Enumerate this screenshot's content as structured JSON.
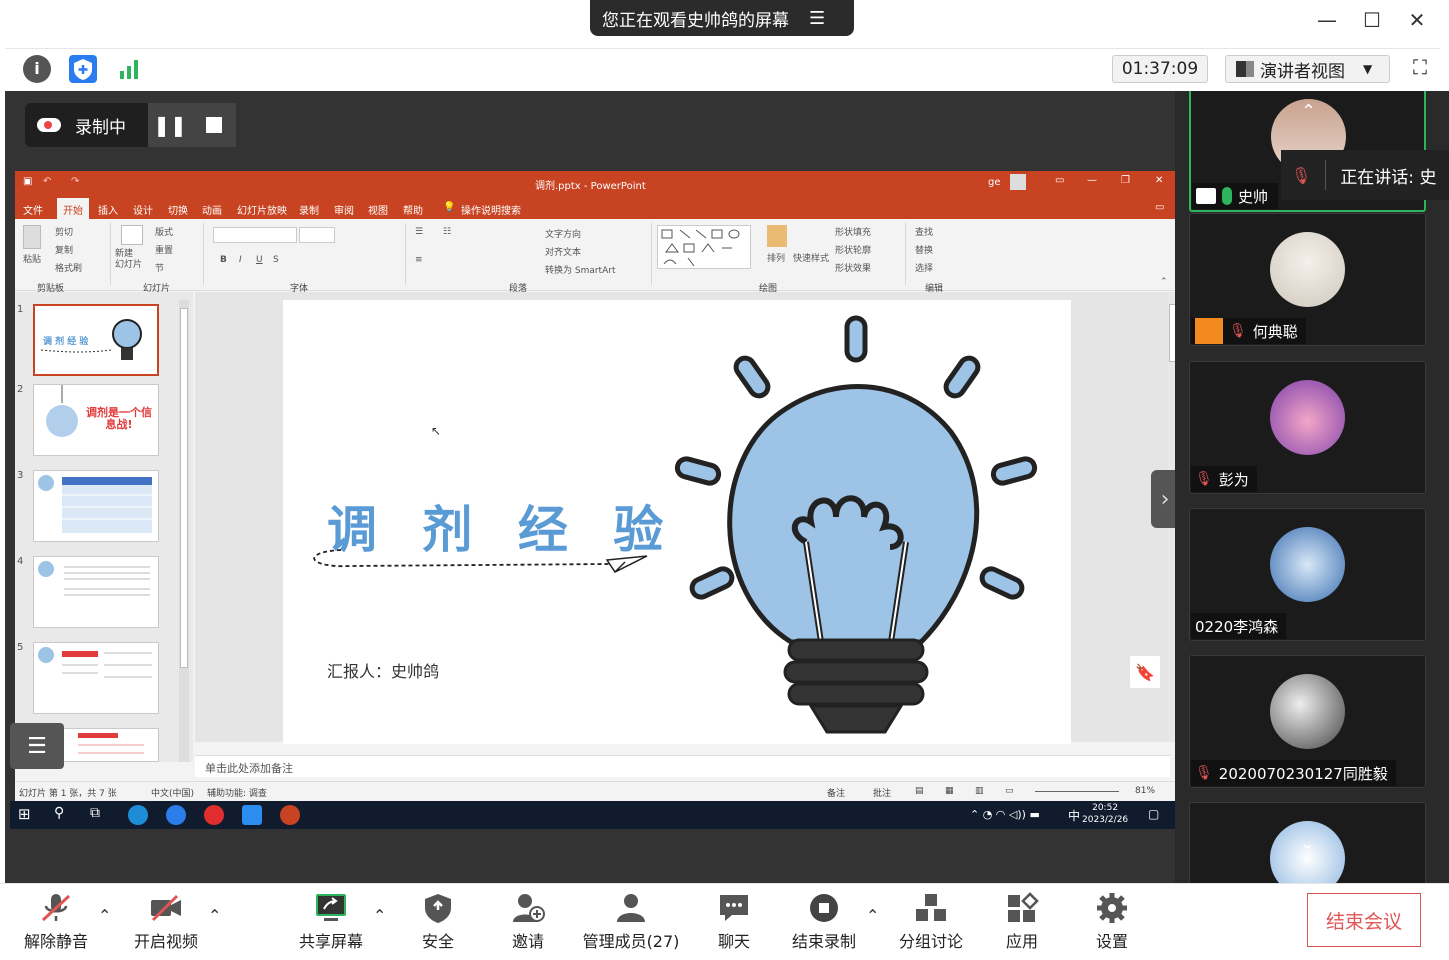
{
  "window": {
    "share_banner": "您正在观看史帅鸽的屏幕",
    "timer": "01:37:09",
    "view_mode": "演讲者视图"
  },
  "recording": {
    "label": "录制中"
  },
  "ppt": {
    "title": "调剂.pptx - PowerPoint",
    "user": "ge",
    "tabs": [
      "文件",
      "开始",
      "插入",
      "设计",
      "切换",
      "动画",
      "幻灯片放映",
      "录制",
      "审阅",
      "视图",
      "帮助",
      "操作说明搜索"
    ],
    "ribbon_groups": [
      "剪贴板",
      "幻灯片",
      "字体",
      "段落",
      "绘图",
      "编辑"
    ],
    "ribbon_items": {
      "cut": "剪切",
      "copy": "复制",
      "format_painter": "格式刷",
      "paste": "粘贴",
      "new_slide": "新建\n幻灯片",
      "layout": "版式",
      "reset": "重置",
      "section": "节",
      "text_direction": "文字方向",
      "align_text": "对齐文本",
      "smartart": "转换为 SmartArt",
      "arrange": "排列",
      "quick_styles": "快速样式",
      "shape_fill": "形状填充",
      "shape_outline": "形状轮廓",
      "shape_effect": "形状效果",
      "find": "查找",
      "replace": "替换",
      "select": "选择"
    },
    "slide_numbers": [
      "1",
      "2",
      "3",
      "4",
      "5",
      "6"
    ],
    "slide": {
      "title": "调 剂 经 验",
      "reporter": "汇报人：史帅鸽"
    },
    "notes_placeholder": "单击此处添加备注",
    "status": {
      "slide_info": "幻灯片 第 1 张，共 7 张",
      "lang": "中文(中国)",
      "accessibility": "辅助功能: 调查",
      "notes": "备注",
      "comments": "批注",
      "zoom": "81%"
    },
    "thumb2_text": "调剂是一个信息战!"
  },
  "taskbar": {
    "time": "20:52",
    "date": "2023/2/26",
    "ime": "中"
  },
  "participants": [
    {
      "name": "史帅",
      "speaking_label": "正在讲话: 史"
    },
    {
      "name": "何典聪"
    },
    {
      "name": "彭为"
    },
    {
      "name": "0220李鸿森"
    },
    {
      "name": "2020070230127同胜毅"
    }
  ],
  "toolbar": {
    "unmute": "解除静音",
    "video": "开启视频",
    "share": "共享屏幕",
    "security": "安全",
    "invite": "邀请",
    "members": "管理成员(27)",
    "chat": "聊天",
    "stop_rec": "结束录制",
    "breakout": "分组讨论",
    "apps": "应用",
    "settings": "设置",
    "end": "结束会议"
  },
  "colors": {
    "ppt_accent": "#c84321",
    "slide_blue": "#5b9bd5",
    "end_red": "#e05555"
  }
}
